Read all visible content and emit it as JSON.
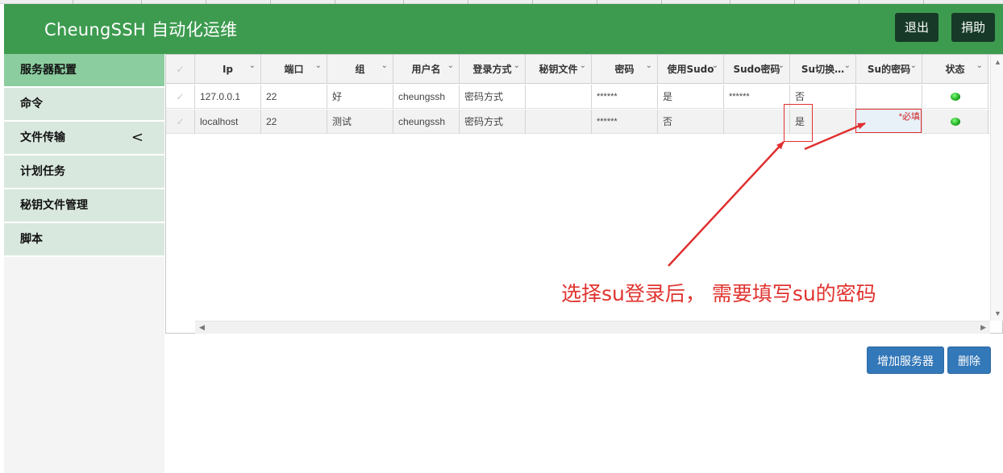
{
  "header": {
    "brand": "CheungSSH 自动化运维",
    "logout_label": "退出",
    "donate_label": "捐助"
  },
  "sidebar": {
    "items": [
      {
        "label": "服务器配置",
        "active": true
      },
      {
        "label": "命令"
      },
      {
        "label": "文件传输",
        "chevron": "<"
      },
      {
        "label": "计划任务"
      },
      {
        "label": "秘钥文件管理"
      },
      {
        "label": "脚本"
      }
    ]
  },
  "table": {
    "columns": [
      "Ip",
      "端口",
      "组",
      "用户名",
      "登录方式",
      "秘钥文件",
      "密码",
      "使用Sudo",
      "Sudo密码",
      "Su切换…",
      "Su的密码",
      "状态"
    ],
    "rows": [
      {
        "ip": "127.0.0.1",
        "port": "22",
        "group": "好",
        "user": "cheungssh",
        "login": "密码方式",
        "keyfile": "",
        "password": "******",
        "sudo": "是",
        "sudo_password": "******",
        "su": "否",
        "su_password": "",
        "status": "online"
      },
      {
        "ip": "localhost",
        "port": "22",
        "group": "测试",
        "user": "cheungssh",
        "login": "密码方式",
        "keyfile": "",
        "password": "******",
        "sudo": "否",
        "sudo_password": "",
        "su": "是",
        "su_password": "",
        "su_password_hint": "*必填",
        "status": "online"
      }
    ]
  },
  "actions": {
    "add_label": "增加服务器",
    "delete_label": "删除"
  },
  "annotation": {
    "text": "选择su登录后， 需要填写su的密码"
  },
  "colors": {
    "header_bg": "#3d9b4f",
    "active_menu": "#8ccda0",
    "menu_bg": "#d9e8df",
    "primary_button": "#3378b8",
    "annotation_red": "#e0332f",
    "status_green": "#19b019"
  }
}
